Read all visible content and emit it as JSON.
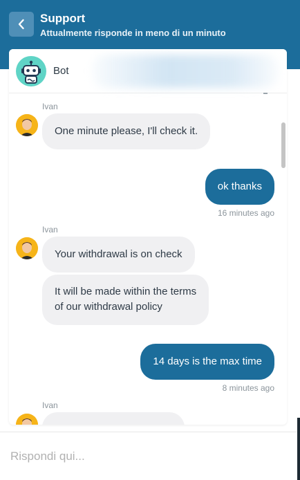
{
  "header": {
    "title": "Support",
    "subtitle": "Attualmente risponde in meno di un minuto",
    "back_icon": "chevron-left-icon",
    "bg_color": "#1c6d9b"
  },
  "agent_bar": {
    "name": "Bot",
    "avatar_icon": "robot-icon"
  },
  "messages": [
    {
      "sender": "Ivan",
      "text": "One minute please, I'll check it."
    },
    {
      "text": "ok thanks",
      "time": "16 minutes ago"
    },
    {
      "sender": "Ivan",
      "text": "Your withdrawal is on check"
    },
    {
      "text_line1": "It will be made within the terms",
      "text_line2": "of our withdrawal policy"
    },
    {
      "text": "14 days is the max time",
      "time": "8 minutes ago"
    },
    {
      "sender": "Ivan",
      "text": ""
    }
  ],
  "composer": {
    "placeholder": "Rispondi qui..."
  }
}
